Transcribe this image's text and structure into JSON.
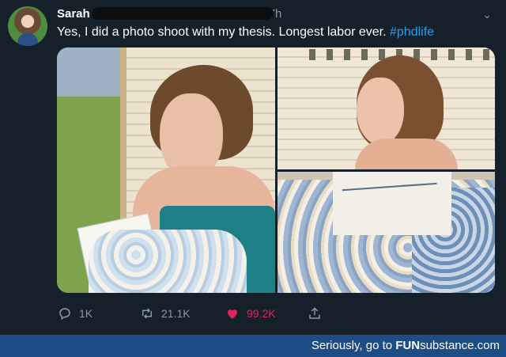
{
  "tweet": {
    "author_name": "Sarah",
    "timestamp": "7h",
    "text": "Yes, I did a photo shoot with my thesis. Longest labor ever. ",
    "hashtag": "#phdlife",
    "menu_icon": "chevron-down-icon"
  },
  "media": {
    "photos": [
      "photo-1",
      "photo-2",
      "photo-3"
    ]
  },
  "actions": {
    "reply_count": "1K",
    "retweet_count": "21.1K",
    "like_count": "99.2K",
    "reply_icon": "reply-icon",
    "retweet_icon": "retweet-icon",
    "like_icon": "heart-icon",
    "share_icon": "share-icon"
  },
  "footer": {
    "prefix": "Seriously, go to ",
    "brand_a": "FUN",
    "brand_b": "substance",
    "suffix": ".com"
  },
  "colors": {
    "background": "#15202b",
    "accent": "#1da1f2",
    "like": "#e0245e",
    "muted": "#8899a6",
    "footer": "#1e4d85"
  }
}
